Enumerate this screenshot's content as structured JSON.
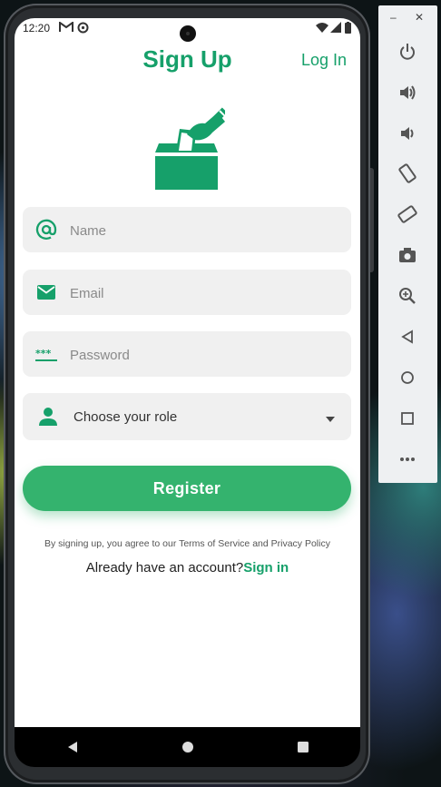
{
  "status_bar": {
    "time": "12:20"
  },
  "header": {
    "title": "Sign Up",
    "login_link": "Log In"
  },
  "form": {
    "name_placeholder": "Name",
    "email_placeholder": "Email",
    "password_placeholder": "Password",
    "role_placeholder": "Choose your role",
    "register_label": "Register"
  },
  "footer": {
    "terms_text": "By signing up, you agree to our Terms of Service and Privacy Policy",
    "account_prompt": "Already have an account?",
    "signin_link": "Sign in"
  },
  "colors": {
    "accent": "#16a06a",
    "button": "#34b36e",
    "field_bg": "#f0f0f0"
  },
  "emulator_panel": {
    "window_controls": [
      "minimize-icon",
      "close-icon"
    ],
    "tools": [
      "power-icon",
      "volume-up-icon",
      "volume-down-icon",
      "rotate-left-icon",
      "rotate-right-icon",
      "camera-icon",
      "zoom-icon",
      "back-icon",
      "home-icon",
      "overview-icon",
      "more-icon"
    ]
  }
}
